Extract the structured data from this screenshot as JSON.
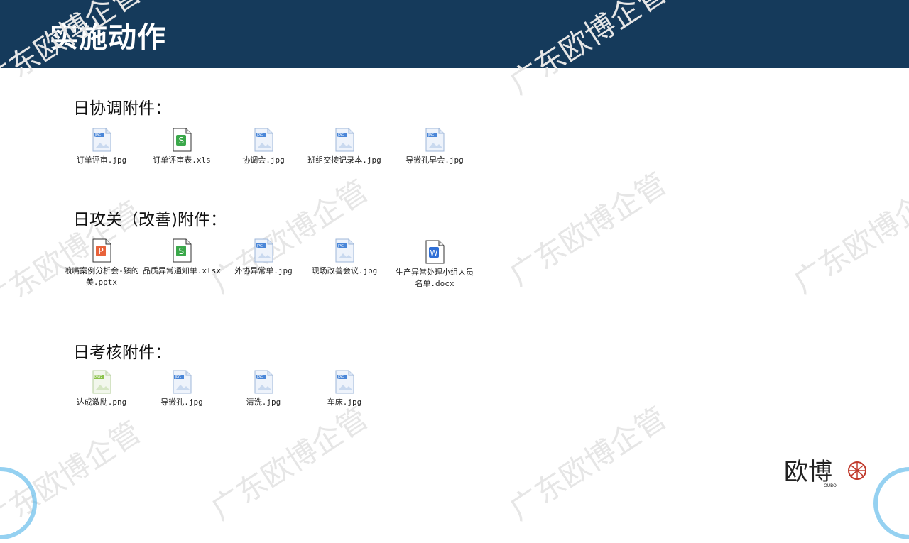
{
  "header": {
    "title": "实施动作"
  },
  "watermark": {
    "text": "广东欧博企管"
  },
  "sections": [
    {
      "title": "日协调附件：",
      "files": [
        {
          "name": "订单评审.jpg",
          "type": "jpg"
        },
        {
          "name": "订单评审表.xls",
          "type": "xls"
        },
        {
          "name": "协调会.jpg",
          "type": "jpg"
        },
        {
          "name": "班组交接记录本.jpg",
          "type": "jpg"
        },
        {
          "name": "导微孔早会.jpg",
          "type": "jpg"
        }
      ]
    },
    {
      "title": "日攻关（改善)附件：",
      "files": [
        {
          "name": "喷嘴案例分析会-臻的美.pptx",
          "type": "pptx"
        },
        {
          "name": "品质异常通知单.xlsx",
          "type": "xls"
        },
        {
          "name": "外协异常单.jpg",
          "type": "jpg"
        },
        {
          "name": "现场改善会议.jpg",
          "type": "jpg"
        },
        {
          "name": "生产异常处理小组人员名单.docx",
          "type": "docx"
        }
      ]
    },
    {
      "title": "日考核附件：",
      "files": [
        {
          "name": "达成激励.png",
          "type": "png"
        },
        {
          "name": "导微孔.jpg",
          "type": "jpg"
        },
        {
          "name": "清洗.jpg",
          "type": "jpg"
        },
        {
          "name": "车床.jpg",
          "type": "jpg"
        }
      ]
    }
  ],
  "logo": {
    "text": "欧博",
    "sub": "OUBO"
  },
  "colors": {
    "header_bg": "#153a5b",
    "jpg": "#4a86d8",
    "xls": "#3aa84a",
    "pptx": "#e8623a",
    "docx": "#2f6fd6",
    "png": "#8bc34a"
  }
}
